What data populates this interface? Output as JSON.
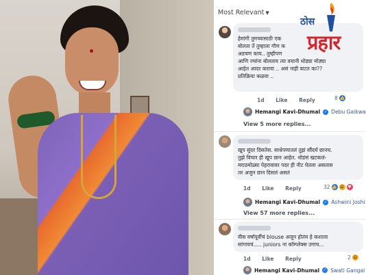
{
  "header": {
    "sort_label": "Most Relevant"
  },
  "logo": {
    "small": "ठोस",
    "big": "प्रहार"
  },
  "comments": [
    {
      "text_lines": [
        "हेमांगी तुमच्यासाठी एक",
        "बोलता तें तुम्हाला गौण क",
        "अडचण काय.. तुम्हीपण",
        "आणि ज्यांना बोलताय त्या वयानी थोड्या मोठ्या",
        "आहेत आदर करावा .. असं नाही वाटत का??",
        "प्रतिक्रिया कळवा .."
      ],
      "time": "1d",
      "like": "Like",
      "reply": "Reply",
      "reactions": "8",
      "reply_author": "Hemangi Kavi-Dhumal",
      "reply_mention": "Debu Gaikwad",
      "more_replies": "View 5 more replies..."
    },
    {
      "text_lines": [
        "खूप सुंदर दिसतेस. साधेपणातलं तुझं सौंदर्य छानच.",
        "तुझे विचार ही खूप छान आहेत. थोडंसं खटकलं-",
        "मराठमोळ्या पेहरावावर पदर ही नीट घेतला असतास",
        "तर अजुन छान दिसलं असतं"
      ],
      "time": "1d",
      "like": "Like",
      "reply": "Reply",
      "reactions": "32",
      "reply_author": "Hemangi Kavi-Dhumal",
      "reply_mention": "Ashwini Joshi th",
      "more_replies": "View 57 more replies..."
    },
    {
      "text_lines": [
        "वीस वर्षापूर्वीचं blouse अजून होतंय हे कशाला",
        "सांगायचं..... juniors ना कॉम्प्लेक्स उगाच..."
      ],
      "time": "1d",
      "like": "Like",
      "reply": "Reply",
      "reactions": "2",
      "reply_author": "Hemangi Kavi-Dhumal",
      "reply_mention": "Swati Gangal se"
    }
  ],
  "colors": {
    "link": "#385898",
    "bubble": "#f0f2f5",
    "logo_blue": "#1f4fa0",
    "logo_red": "#d3272d"
  }
}
